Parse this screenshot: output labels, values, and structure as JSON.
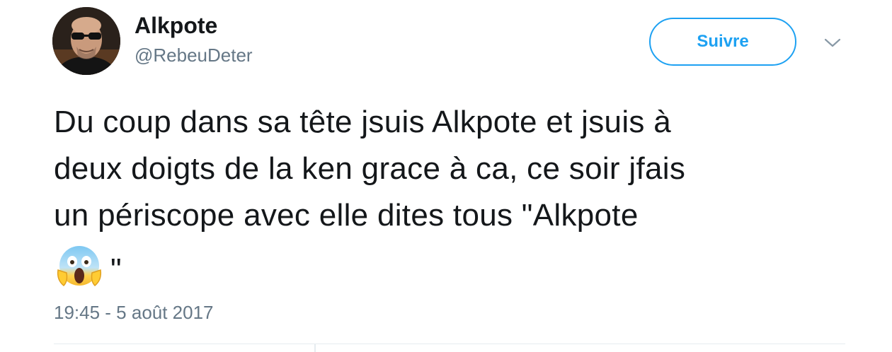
{
  "tweet": {
    "author": {
      "display_name": "Alkpote",
      "handle": "@RebeuDeter",
      "avatar": "profile-photo"
    },
    "follow_label": "Suivre",
    "menu_icon": "chevron-down-icon",
    "text_line_1": "Du coup dans sa tête jsuis Alkpote et jsuis à",
    "text_line_2": "deux doigts de la ken grace à ca, ce soir jfais",
    "text_line_3": "un périscope avec elle dites tous \"Alkpote",
    "emoji": "face-screaming-in-fear",
    "text_end": "\"",
    "timestamp": "19:45 - 5 août 2017"
  },
  "colors": {
    "accent": "#1da1f2",
    "text": "#14171a",
    "muted": "#657786",
    "divider": "#e6ecf0"
  }
}
